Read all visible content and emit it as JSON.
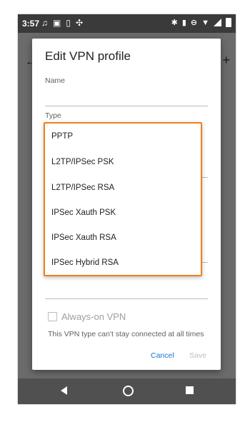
{
  "status_bar": {
    "time": "3:57"
  },
  "dialog": {
    "title": "Edit VPN profile",
    "name_label": "Name",
    "type_label": "Type",
    "always_on_label": "Always-on VPN",
    "note": "This VPN type can't stay connected at all times",
    "cancel_label": "Cancel",
    "save_label": "Save"
  },
  "dropdown": {
    "options": [
      "PPTP",
      "L2TP/IPSec PSK",
      "L2TP/IPSec RSA",
      "IPSec Xauth PSK",
      "IPSec Xauth RSA",
      "IPSec Hybrid RSA"
    ],
    "highlight_color": "#f07f1a"
  },
  "colors": {
    "accent": "#1976d2",
    "disabled": "#bdbdbd"
  }
}
